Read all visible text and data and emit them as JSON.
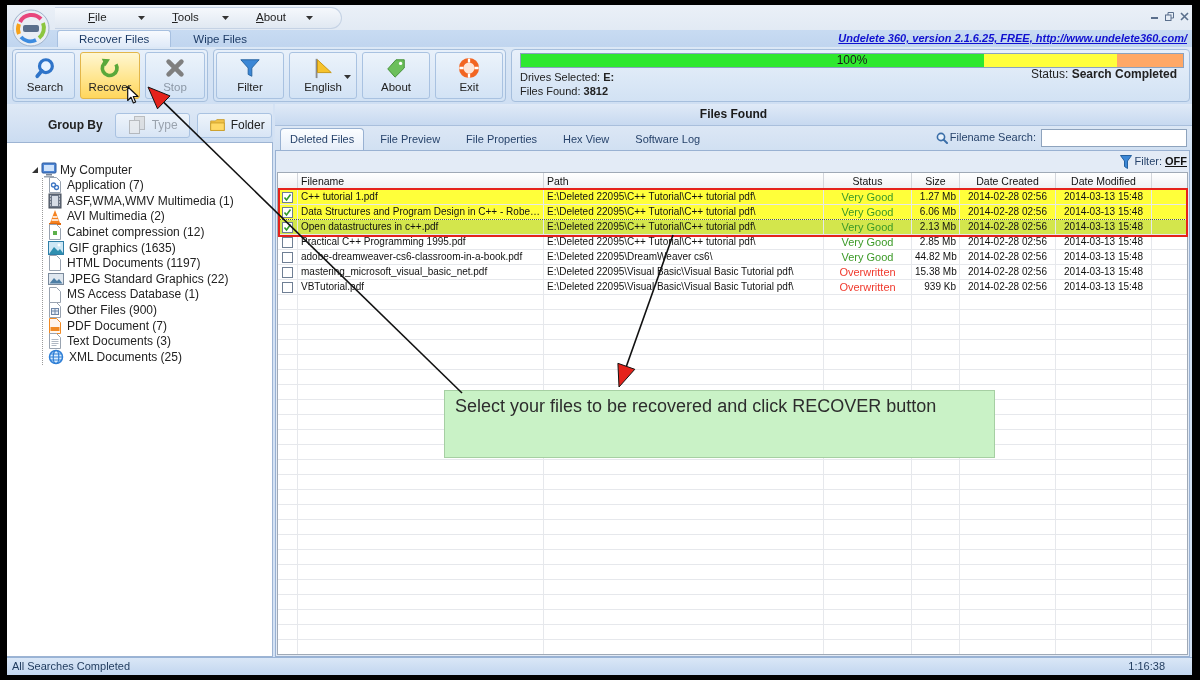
{
  "window": {
    "menus": [
      {
        "label": "File"
      },
      {
        "label": "Tools"
      },
      {
        "label": "About"
      }
    ],
    "tabs": [
      {
        "label": "Recover Files",
        "selected": true
      },
      {
        "label": "Wipe Files",
        "selected": false
      }
    ],
    "version_link": "Undelete 360, version 2.1.6.25, FREE, http://www.undelete360.com/"
  },
  "toolbar": {
    "groups": [
      {
        "buttons": [
          {
            "label": "Search",
            "kind": "search",
            "hovered": false,
            "disabled": false,
            "dropdown": false
          },
          {
            "label": "Recover",
            "kind": "recover",
            "hovered": true,
            "disabled": false,
            "dropdown": false
          },
          {
            "label": "Stop",
            "kind": "stop",
            "hovered": false,
            "disabled": true,
            "dropdown": false
          }
        ]
      },
      {
        "buttons": [
          {
            "label": "Filter",
            "kind": "filter",
            "hovered": false,
            "disabled": false,
            "dropdown": false
          },
          {
            "label": "English",
            "kind": "language",
            "hovered": false,
            "disabled": false,
            "dropdown": true
          },
          {
            "label": "About",
            "kind": "about",
            "hovered": false,
            "disabled": false,
            "dropdown": false
          },
          {
            "label": "Exit",
            "kind": "exit",
            "hovered": false,
            "disabled": false,
            "dropdown": false
          }
        ]
      }
    ]
  },
  "scan": {
    "progress": {
      "level": 1,
      "reading": "100%"
    },
    "drives": "Drives Selected: **E:**",
    "files_found": "Files Found: **3812**",
    "status": "Status: **Search Completed**"
  },
  "group_by": {
    "label": "Group By",
    "buttons": [
      {
        "label": "Type",
        "kind": "type",
        "disabled": true
      },
      {
        "label": "Folder",
        "kind": "folder",
        "disabled": false
      }
    ]
  },
  "tree": [
    {
      "label": "My Computer",
      "kind": "computer",
      "expanded": true,
      "children": [
        {
          "label": "Application (7)",
          "kind": "application"
        },
        {
          "label": "ASF,WMA,WMV Multimedia (1)",
          "kind": "media"
        },
        {
          "label": "AVI Multimedia (2)",
          "kind": "cone"
        },
        {
          "label": "Cabinet compression (12)",
          "kind": "archive"
        },
        {
          "label": "GIF graphics (1635)",
          "kind": "image"
        },
        {
          "label": "HTML Documents (1197)",
          "kind": "page"
        },
        {
          "label": "JPEG Standard Graphics (22)",
          "kind": "photo"
        },
        {
          "label": "MS Access Database (1)",
          "kind": "page"
        },
        {
          "label": "Other Files (900)",
          "kind": "grid"
        },
        {
          "label": "PDF Document (7)",
          "kind": "pdf"
        },
        {
          "label": "Text Documents (3)",
          "kind": "text"
        },
        {
          "label": "XML Documents (25)",
          "kind": "web"
        }
      ]
    }
  ],
  "files": {
    "title": "Files Found",
    "tabs": [
      {
        "label": "Deleted Files",
        "selected": true
      },
      {
        "label": "File Preview",
        "selected": false
      },
      {
        "label": "File Properties",
        "selected": false
      },
      {
        "label": "Hex View",
        "selected": false
      },
      {
        "label": "Software Log",
        "selected": false
      }
    ],
    "search_label": "Filename Search:",
    "filter_label": "Filter:",
    "filter_value": "OFF",
    "table": {
      "columns": [
        "Filename",
        "Path",
        "Status",
        "Size",
        "Date Created",
        "Date Modified"
      ],
      "rows": [
        {
          "checked": true,
          "selected": false,
          "filename": "C++ tutorial 1.pdf",
          "path": "E:\\Deleted 22095\\C++ Tutorial\\C++ tutorial pdf\\",
          "status": "Very Good",
          "color": "#3c9a28",
          "size": "1.27 Mb",
          "created": "2014-02-28 02:56",
          "modified": "2014-03-13 15:48"
        },
        {
          "checked": true,
          "selected": false,
          "filename": "Data Structures and Program Design in C++ - Robe…",
          "path": "E:\\Deleted 22095\\C++ Tutorial\\C++ tutorial pdf\\",
          "status": "Very Good",
          "color": "#3c9a28",
          "size": "6.06 Mb",
          "created": "2014-02-28 02:56",
          "modified": "2014-03-13 15:48"
        },
        {
          "checked": true,
          "selected": true,
          "filename": "Open datastructures in c++.pdf",
          "path": "E:\\Deleted 22095\\C++ Tutorial\\C++ tutorial pdf\\",
          "status": "Very Good",
          "color": "#3c9a28",
          "size": "2.13 Mb",
          "created": "2014-02-28 02:56",
          "modified": "2014-03-13 15:48"
        },
        {
          "checked": false,
          "selected": false,
          "filename": "Practical C++ Programming 1995.pdf",
          "path": "E:\\Deleted 22095\\C++ Tutorial\\C++ tutorial pdf\\",
          "status": "Very Good",
          "color": "#3c9a28",
          "size": "2.85 Mb",
          "created": "2014-02-28 02:56",
          "modified": "2014-03-13 15:48"
        },
        {
          "checked": false,
          "selected": false,
          "filename": "adobe-dreamweaver-cs6-classroom-in-a-book.pdf",
          "path": "E:\\Deleted 22095\\DreamWeaver cs6\\",
          "status": "Very Good",
          "color": "#3c9a28",
          "size": "44.82 Mb",
          "created": "2014-02-28 02:56",
          "modified": "2014-03-13 15:48"
        },
        {
          "checked": false,
          "selected": false,
          "filename": "mastering_microsoft_visual_basic_net.pdf",
          "path": "E:\\Deleted 22095\\Visual Basic\\Visual Basic Tutorial pdf\\",
          "status": "Overwritten",
          "color": "#f03a2e",
          "size": "15.38 Mb",
          "created": "2014-02-28 02:56",
          "modified": "2014-03-13 15:48"
        },
        {
          "checked": false,
          "selected": false,
          "filename": "VBTutorial.pdf",
          "path": "E:\\Deleted 22095\\Visual Basic\\Visual Basic Tutorial pdf\\",
          "status": "Overwritten",
          "color": "#f03a2e",
          "size": "939 Kb",
          "created": "2014-02-28 02:56",
          "modified": "2014-03-13 15:48"
        }
      ]
    }
  },
  "callout": {
    "text": "Select your files to be recovered and click RECOVER button"
  },
  "status_bar": {
    "message": "All Searches Completed",
    "time": "1:16:38"
  }
}
